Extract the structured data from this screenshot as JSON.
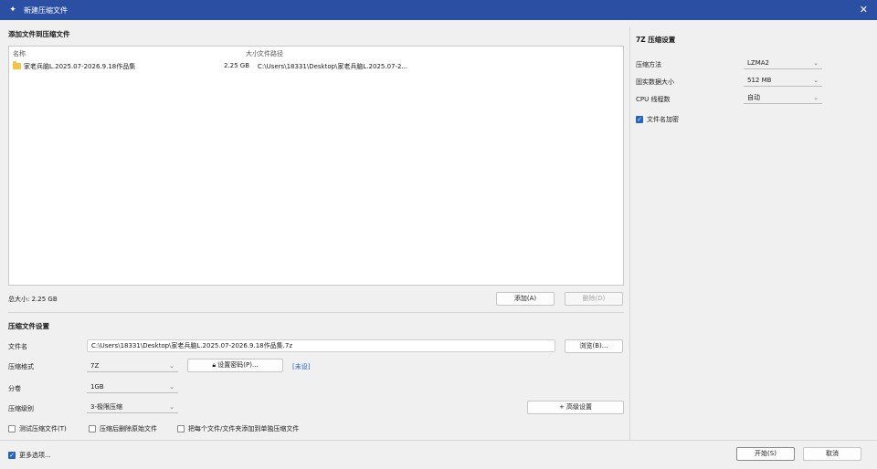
{
  "window": {
    "title": "新建压缩文件",
    "close_glyph": "✕",
    "app_icon_glyph": "✦"
  },
  "add_files": {
    "section_title": "添加文件到压缩文件",
    "columns": [
      "名称",
      "大小",
      "文件路径"
    ],
    "rows": [
      {
        "name": "家老兵脑L.2025.07-2026.9.18作品集",
        "size": "2.25 GB",
        "path": "C:\\Users\\18331\\Desktop\\家老兵脑L.2025.07-2..."
      }
    ],
    "total_size": "总大小: 2.25 GB",
    "add_button": "添加(A)",
    "delete_button": "删除(D)"
  },
  "archive_settings": {
    "section_title": "压缩文件设置",
    "filename_label": "文件名",
    "filename_value": "C:\\Users\\18331\\Desktop\\家老兵脑L.2025.07-2026.9.18作品集.7z",
    "browse_button": "浏览(B)...",
    "format_label": "压缩格式",
    "format_value": "7Z",
    "password_button": "设置密码(P)...",
    "password_icon": "lock-icon",
    "password_status": "[未设]",
    "volume_label": "分卷",
    "volume_value": "1GB",
    "level_label": "压缩级别",
    "level_value": "3-极限压缩",
    "advanced_button": "+ 高级设置",
    "options": [
      {
        "label": "测试压缩文件(T)",
        "checked": false
      },
      {
        "label": "压缩后删除原始文件",
        "checked": false
      },
      {
        "label": "把每个文件/文件夹添加到单独压缩文件",
        "checked": false
      }
    ]
  },
  "sevenz_settings": {
    "section_title": "7Z 压缩设置",
    "method_label": "压缩方法",
    "method_value": "LZMA2",
    "dict_label": "固实数据大小",
    "dict_value": "512 MB",
    "threads_label": "CPU 线程数",
    "threads_value": "自动",
    "encrypt_names_label": "文件名加密",
    "encrypt_names_checked": true
  },
  "footer": {
    "show_more_label": "更多选项...",
    "show_more_checked": true,
    "start_button": "开始(S)",
    "cancel_button": "取消"
  },
  "colors": {
    "titlebar": "#2b4fa3",
    "accent": "#2163c6",
    "link": "#1f5fd1",
    "folder": "#f2c34b"
  }
}
